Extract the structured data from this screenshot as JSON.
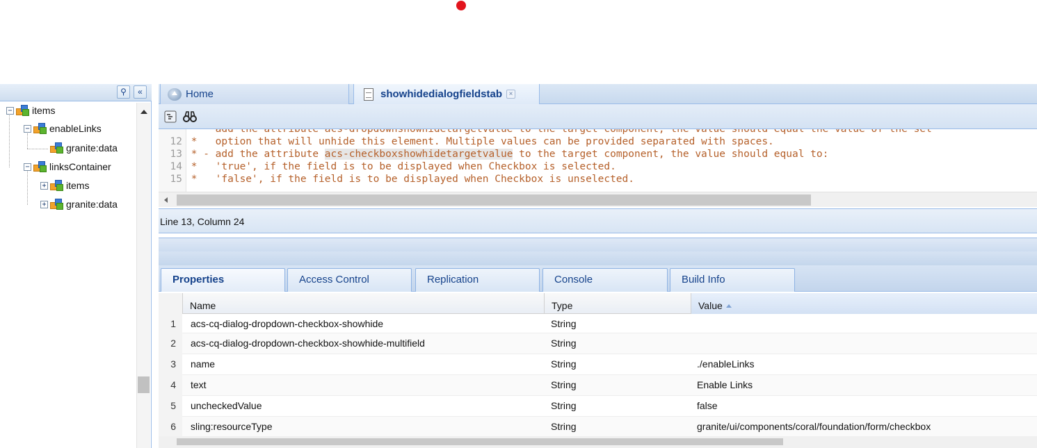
{
  "tree": {
    "nodes": [
      {
        "label": "items",
        "toggle": "−"
      },
      {
        "label": "enableLinks",
        "toggle": "−"
      },
      {
        "label": "granite:data",
        "toggle": ""
      },
      {
        "label": "linksContainer",
        "toggle": "−"
      },
      {
        "label": "items",
        "toggle": "+"
      },
      {
        "label": "granite:data",
        "toggle": "+"
      }
    ]
  },
  "tabs": {
    "home": "Home",
    "active": "showhidedialogfieldstab",
    "close": "×"
  },
  "toolbar": {
    "binoculars": "🔭"
  },
  "editor": {
    "lines": [
      {
        "num": "12",
        "text": " *   option that will unhide this element. Multiple values can be provided separated with spaces."
      },
      {
        "num": "13",
        "pre": " * - add the attribute ",
        "hl": "acs-checkboxshowhidetargetvalue",
        "post": " to the target component, the value should equal to:"
      },
      {
        "num": "14",
        "text": " *   'true', if the field is to be displayed when Checkbox is selected."
      },
      {
        "num": "15",
        "text": " *   'false', if the field is to be displayed when Checkbox is unselected."
      }
    ],
    "partial_top": " *   add the attribute acs-dropdownshowhidetargetvalue to the target component, the value should equal the value of the sel"
  },
  "status": "Line 13, Column 24",
  "property_tabs": [
    "Properties",
    "Access Control",
    "Replication",
    "Console",
    "Build Info"
  ],
  "grid": {
    "columns": [
      "Name",
      "Type",
      "Value"
    ],
    "rows": [
      {
        "n": "1",
        "name": "acs-cq-dialog-dropdown-checkbox-showhide",
        "type": "String",
        "value": ""
      },
      {
        "n": "2",
        "name": "acs-cq-dialog-dropdown-checkbox-showhide-multifield",
        "type": "String",
        "value": ""
      },
      {
        "n": "3",
        "name": "name",
        "type": "String",
        "value": "./enableLinks"
      },
      {
        "n": "4",
        "name": "text",
        "type": "String",
        "value": "Enable Links"
      },
      {
        "n": "5",
        "name": "uncheckedValue",
        "type": "String",
        "value": "false"
      },
      {
        "n": "6",
        "name": "sling:resourceType",
        "type": "String",
        "value": "granite/ui/components/coral/foundation/form/checkbox"
      }
    ]
  },
  "colors": {
    "accent": "#15428b",
    "border": "#99bbe8",
    "code": "#b5602a",
    "record": "#e2141d"
  }
}
